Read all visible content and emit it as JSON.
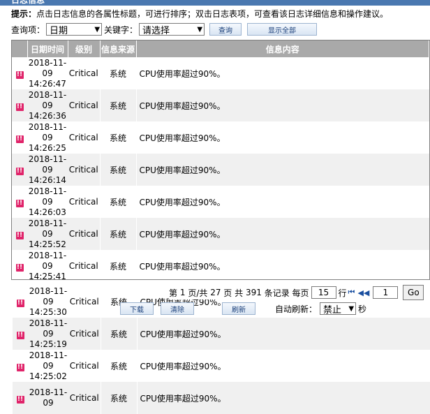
{
  "window_title": "日志信息",
  "hint": {
    "label": "提示：",
    "text": "点击日志信息的各属性标题，可进行排序；双击日志表项，可查看该日志详细信息和操作建议。"
  },
  "query": {
    "field_label": "查询项：",
    "field_value": "日期",
    "keyword_label": "关键字：",
    "keyword_value": "请选择",
    "search_btn": "查询",
    "show_all_btn": "显示全部"
  },
  "table": {
    "headers": [
      "",
      "日期时间",
      "级别",
      "信息来源",
      "信息内容"
    ],
    "rows": [
      {
        "date": "2018-11-",
        "day": "09",
        "time": "14:26:47",
        "level": "Critical",
        "source": "系统",
        "message": "CPU使用率超过90%。"
      },
      {
        "date": "2018-11-",
        "day": "09",
        "time": "14:26:36",
        "level": "Critical",
        "source": "系统",
        "message": "CPU使用率超过90%。"
      },
      {
        "date": "2018-11-",
        "day": "09",
        "time": "14:26:25",
        "level": "Critical",
        "source": "系统",
        "message": "CPU使用率超过90%。"
      },
      {
        "date": "2018-11-",
        "day": "09",
        "time": "14:26:14",
        "level": "Critical",
        "source": "系统",
        "message": "CPU使用率超过90%。"
      },
      {
        "date": "2018-11-",
        "day": "09",
        "time": "14:26:03",
        "level": "Critical",
        "source": "系统",
        "message": "CPU使用率超过90%。"
      },
      {
        "date": "2018-11-",
        "day": "09",
        "time": "14:25:52",
        "level": "Critical",
        "source": "系统",
        "message": "CPU使用率超过90%。"
      },
      {
        "date": "2018-11-",
        "day": "09",
        "time": "14:25:41",
        "level": "Critical",
        "source": "系统",
        "message": "CPU使用率超过90%。"
      }
    ],
    "overflow_rows": [
      {
        "date": "2018-11-",
        "day": "09",
        "time": "14:25:30",
        "level": "Critical",
        "source": "系统",
        "message": "CPU使用率超过90%。"
      },
      {
        "date": "2018-11-",
        "day": "09",
        "time": "14:25:19",
        "level": "Critical",
        "source": "系统",
        "message": "CPU使用率超过90%。"
      },
      {
        "date": "2018-11-",
        "day": "09",
        "time": "14:25:02",
        "level": "Critical",
        "source": "系统",
        "message": "CPU使用率超过90%。"
      },
      {
        "date": "2018-11-",
        "day": "09",
        "time": "",
        "level": "Critical",
        "source": "系统",
        "message": "CPU使用率超过90%。"
      }
    ]
  },
  "pager": {
    "prefix": "第",
    "page": "1",
    "mid1": "页/共",
    "total_pages": "27",
    "mid2": "页 共",
    "total_records": "391",
    "mid3": "条记录 每页",
    "per_page": "15",
    "mid4": "行",
    "goto_page": "1",
    "go_btn": "Go"
  },
  "actions": {
    "download": "下载",
    "clear": "清除",
    "refresh": "刷新",
    "auto_label": "自动刷新：",
    "auto_value": "禁止",
    "seconds": "秒"
  },
  "icons": {
    "severity": "critical-alert-icon",
    "first_page": "first-page-icon",
    "prev_page": "prev-page-icon"
  },
  "colors": {
    "severity": "#e0246a",
    "header": "#a9a9a9",
    "title_bar": "#4a78b0"
  }
}
